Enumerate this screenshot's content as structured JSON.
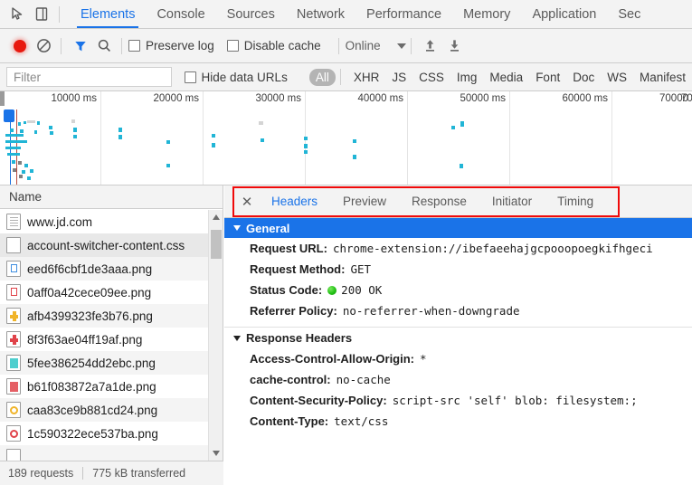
{
  "main_tabs": [
    {
      "label": "Elements",
      "active": false
    },
    {
      "label": "Console",
      "active": false
    },
    {
      "label": "Sources",
      "active": false
    },
    {
      "label": "Network",
      "active": true
    },
    {
      "label": "Performance",
      "active": false
    },
    {
      "label": "Memory",
      "active": false
    },
    {
      "label": "Application",
      "active": false
    },
    {
      "label": "Sec",
      "active": false
    }
  ],
  "toolbar": {
    "record_title": "record-button",
    "clear_title": "clear-button",
    "filter_title": "filter-button",
    "search_title": "search-button",
    "preserve_log": "Preserve log",
    "disable_cache": "Disable cache",
    "throttle_value": "Online",
    "import_title": "import-har",
    "export_title": "export-har"
  },
  "filterbar": {
    "placeholder": "Filter",
    "value": "",
    "hide_data_urls": "Hide data URLs",
    "types": [
      {
        "label": "All",
        "active": true
      },
      {
        "label": "XHR",
        "active": false
      },
      {
        "label": "JS",
        "active": false
      },
      {
        "label": "CSS",
        "active": false
      },
      {
        "label": "Img",
        "active": false
      },
      {
        "label": "Media",
        "active": false
      },
      {
        "label": "Font",
        "active": false
      },
      {
        "label": "Doc",
        "active": false
      },
      {
        "label": "WS",
        "active": false
      },
      {
        "label": "Manifest",
        "active": false
      }
    ]
  },
  "overview": {
    "ticks": [
      "10000 ms",
      "20000 ms",
      "30000 ms",
      "40000 ms",
      "50000 ms",
      "60000 ms",
      "70000"
    ]
  },
  "request_list": {
    "column_header": "Name",
    "rows": [
      {
        "name": "www.jd.com",
        "icon": "document-icon",
        "color": "#9b9b9b",
        "glyph": "doc",
        "selected": false
      },
      {
        "name": "account-switcher-content.css",
        "icon": "stylesheet-icon",
        "color": "#ffffff",
        "glyph": "blank",
        "selected": true
      },
      {
        "name": "eed6f6cbf1de3aaa.png",
        "icon": "image-icon",
        "color": "#3f8ee0",
        "glyph": "sq",
        "selected": false
      },
      {
        "name": "0aff0a42cece09ee.png",
        "icon": "image-icon",
        "color": "#e0434a",
        "glyph": "sq",
        "selected": false
      },
      {
        "name": "afb4399323fe3b76.png",
        "icon": "image-icon",
        "color": "#f0b429",
        "glyph": "cross",
        "selected": false
      },
      {
        "name": "8f3f63ae04ff19af.png",
        "icon": "image-icon",
        "color": "#e0434a",
        "glyph": "cross",
        "selected": false
      },
      {
        "name": "5fee386254dd2ebc.png",
        "icon": "image-icon",
        "color": "#2fc6c6",
        "glyph": "fill",
        "selected": false
      },
      {
        "name": "b61f083872a7a1de.png",
        "icon": "image-icon",
        "color": "#e0434a",
        "glyph": "fill",
        "selected": false
      },
      {
        "name": "caa83ce9b881cd24.png",
        "icon": "image-icon",
        "color": "#f0b429",
        "glyph": "ring",
        "selected": false
      },
      {
        "name": "1c590322ece537ba.png",
        "icon": "image-icon",
        "color": "#e0434a",
        "glyph": "ring",
        "selected": false
      }
    ],
    "footer_requests": "189 requests",
    "footer_transferred": "775 kB transferred"
  },
  "details": {
    "close_label": "✕",
    "tabs": [
      {
        "label": "Headers",
        "active": true
      },
      {
        "label": "Preview",
        "active": false
      },
      {
        "label": "Response",
        "active": false
      },
      {
        "label": "Initiator",
        "active": false
      },
      {
        "label": "Timing",
        "active": false
      }
    ],
    "general_title": "General",
    "general_rows": [
      {
        "key": "Request URL:",
        "value": "chrome-extension://ibefaeehajgcpooopoegkifhgeci"
      },
      {
        "key": "Request Method:",
        "value": "GET"
      },
      {
        "key": "Status Code:",
        "value": "200 OK",
        "status": true
      },
      {
        "key": "Referrer Policy:",
        "value": "no-referrer-when-downgrade"
      }
    ],
    "response_title": "Response Headers",
    "response_rows": [
      {
        "key": "Access-Control-Allow-Origin:",
        "value": "*"
      },
      {
        "key": "cache-control:",
        "value": "no-cache"
      },
      {
        "key": "Content-Security-Policy:",
        "value": "script-src 'self' blob: filesystem:;"
      },
      {
        "key": "Content-Type:",
        "value": "text/css"
      }
    ]
  },
  "colors": {
    "accent": "#1a73e8",
    "highlight": "#f00a0a",
    "record": "#e8190f",
    "status_ok": "#22c016",
    "timeline_dot": "#21b5d6"
  }
}
